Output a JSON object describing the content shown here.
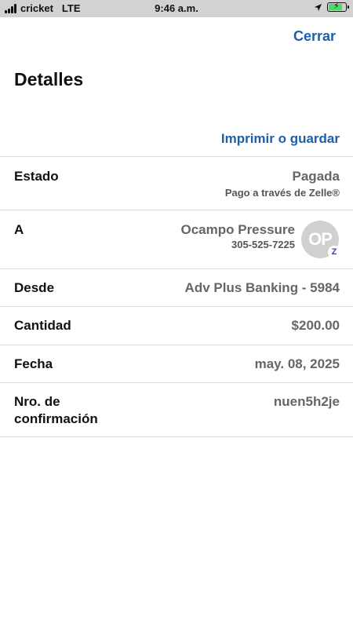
{
  "status_bar": {
    "carrier": "cricket",
    "network": "LTE",
    "time": "9:46 a.m."
  },
  "header": {
    "close_label": "Cerrar",
    "title": "Detalles",
    "print_label": "Imprimir o guardar"
  },
  "details": {
    "status": {
      "label": "Estado",
      "value": "Pagada",
      "sub": "Pago a través de Zelle®"
    },
    "to": {
      "label": "A",
      "name": "Ocampo Pressure",
      "phone": "305-525-7225",
      "initials": "OP",
      "badge": "Z"
    },
    "from": {
      "label": "Desde",
      "value": "Adv Plus Banking - 5984"
    },
    "amount": {
      "label": "Cantidad",
      "value": "$200.00"
    },
    "date": {
      "label": "Fecha",
      "value": "may. 08, 2025"
    },
    "confirmation": {
      "label_line1": "Nro. de",
      "label_line2": "confirmación",
      "value": "nuen5h2je"
    }
  },
  "colors": {
    "link": "#1b5fad",
    "status_bar": "#d2d2d2",
    "battery": "#4cd964",
    "zelle": "#6d1ed4"
  },
  "icons": [
    "signal-icon",
    "location-arrow-icon",
    "battery-charging-icon",
    "zelle-icon"
  ]
}
